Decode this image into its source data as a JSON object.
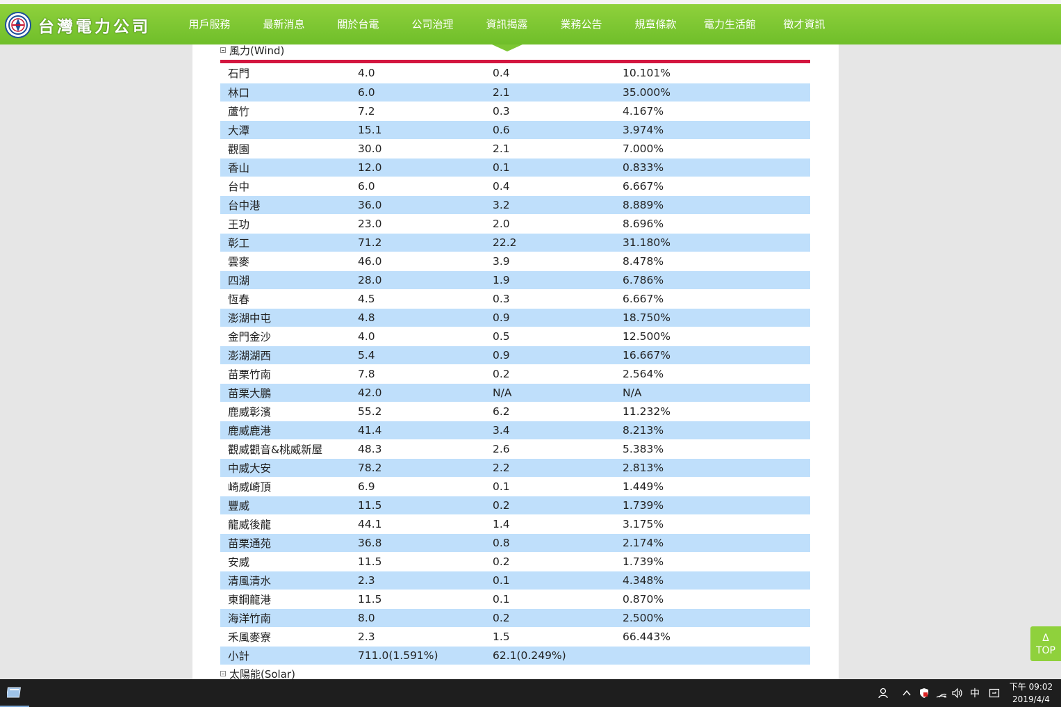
{
  "header": {
    "brand": "台灣電力公司",
    "nav": [
      "用戶服務",
      "最新消息",
      "關於台電",
      "公司治理",
      "資訊揭露",
      "業務公告",
      "規章條款",
      "電力生活館",
      "徵才資訊"
    ],
    "active_index": 4
  },
  "wind": {
    "title": "風力(Wind)",
    "rows": [
      [
        "石門",
        "4.0",
        "0.4",
        "10.101%"
      ],
      [
        "林口",
        "6.0",
        "2.1",
        "35.000%"
      ],
      [
        "蘆竹",
        "7.2",
        "0.3",
        "4.167%"
      ],
      [
        "大潭",
        "15.1",
        "0.6",
        "3.974%"
      ],
      [
        "觀園",
        "30.0",
        "2.1",
        "7.000%"
      ],
      [
        "香山",
        "12.0",
        "0.1",
        "0.833%"
      ],
      [
        "台中",
        "6.0",
        "0.4",
        "6.667%"
      ],
      [
        "台中港",
        "36.0",
        "3.2",
        "8.889%"
      ],
      [
        "王功",
        "23.0",
        "2.0",
        "8.696%"
      ],
      [
        "彰工",
        "71.2",
        "22.2",
        "31.180%"
      ],
      [
        "雲麥",
        "46.0",
        "3.9",
        "8.478%"
      ],
      [
        "四湖",
        "28.0",
        "1.9",
        "6.786%"
      ],
      [
        "恆春",
        "4.5",
        "0.3",
        "6.667%"
      ],
      [
        "澎湖中屯",
        "4.8",
        "0.9",
        "18.750%"
      ],
      [
        "金門金沙",
        "4.0",
        "0.5",
        "12.500%"
      ],
      [
        "澎湖湖西",
        "5.4",
        "0.9",
        "16.667%"
      ],
      [
        "苗栗竹南",
        "7.8",
        "0.2",
        "2.564%"
      ],
      [
        "苗栗大鵬",
        "42.0",
        "N/A",
        "N/A"
      ],
      [
        "鹿威彰濱",
        "55.2",
        "6.2",
        "11.232%"
      ],
      [
        "鹿威鹿港",
        "41.4",
        "3.4",
        "8.213%"
      ],
      [
        "觀威觀音&桃威新屋",
        "48.3",
        "2.6",
        "5.383%"
      ],
      [
        "中威大安",
        "78.2",
        "2.2",
        "2.813%"
      ],
      [
        "崎威崎頂",
        "6.9",
        "0.1",
        "1.449%"
      ],
      [
        "豐威",
        "11.5",
        "0.2",
        "1.739%"
      ],
      [
        "龍威後龍",
        "44.1",
        "1.4",
        "3.175%"
      ],
      [
        "苗栗通苑",
        "36.8",
        "0.8",
        "2.174%"
      ],
      [
        "安威",
        "11.5",
        "0.2",
        "1.739%"
      ],
      [
        "清風清水",
        "2.3",
        "0.1",
        "4.348%"
      ],
      [
        "東鋼龍港",
        "11.5",
        "0.1",
        "0.870%"
      ],
      [
        "海洋竹南",
        "8.0",
        "0.2",
        "2.500%"
      ],
      [
        "禾風麥寮",
        "2.3",
        "1.5",
        "66.443%"
      ],
      [
        "小計",
        "711.0(1.591%)",
        "62.1(0.249%)",
        ""
      ]
    ]
  },
  "solar": {
    "title": "太陽能(Solar)"
  },
  "top_button": {
    "arrow": "Δ",
    "label": "TOP"
  },
  "taskbar": {
    "ime": "中",
    "time": "下午 09:02",
    "date": "2019/4/4"
  }
}
